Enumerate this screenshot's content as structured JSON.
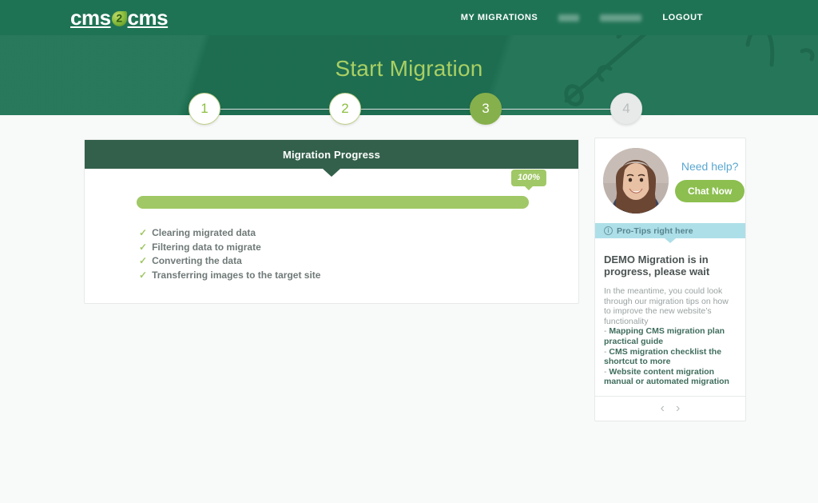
{
  "topbar": {
    "logo_text_left": "cms",
    "logo_text_right": "cms",
    "logo_mark": "number-2-leaf-logo",
    "nav": {
      "my_migrations": "MY MIGRATIONS",
      "redacted_1": "",
      "redacted_2": "",
      "logout": "LOGOUT"
    }
  },
  "hero": {
    "title": "Start Migration"
  },
  "stepper": {
    "steps": [
      {
        "label": "1",
        "state": "done"
      },
      {
        "label": "2",
        "state": "done"
      },
      {
        "label": "3",
        "state": "active"
      },
      {
        "label": "4",
        "state": "idle"
      }
    ]
  },
  "progress_card": {
    "header": "Migration Progress",
    "percent_label": "100%",
    "percent_value": 100,
    "checklist": [
      {
        "check": "✓",
        "label": "Clearing migrated data"
      },
      {
        "check": "✓",
        "label": "Filtering data to migrate"
      },
      {
        "check": "✓",
        "label": "Converting the data"
      },
      {
        "check": "✓",
        "label": "Transferring images to the target site"
      }
    ]
  },
  "help_panel": {
    "avatar_alt": "support-agent-photo",
    "need_help": "Need help?",
    "chat_button": "Chat Now",
    "protips": {
      "icon": "info-circle-icon",
      "label": "Pro-Tips right here"
    },
    "tips": {
      "title": "DEMO Migration is in progress, please wait",
      "intro": "In the meantime, you could look through our migration tips on how to improve the new website’s functionality",
      "bullet": "-",
      "links": [
        "Mapping CMS migration plan practical guide",
        "CMS migration checklist the shortcut to more",
        "Website content migration manual or automated migration"
      ]
    },
    "nav": {
      "prev": "‹",
      "next": "›"
    }
  },
  "colors": {
    "brand_green": "#1f7355",
    "header_green": "#33604b",
    "accent_green": "#a0c866",
    "button_green": "#8cbf4f",
    "title_green": "#a9cf63",
    "tips_blue": "#addfe8",
    "link_blue": "#5aa7cf",
    "page_bg": "#f8f9f9"
  }
}
